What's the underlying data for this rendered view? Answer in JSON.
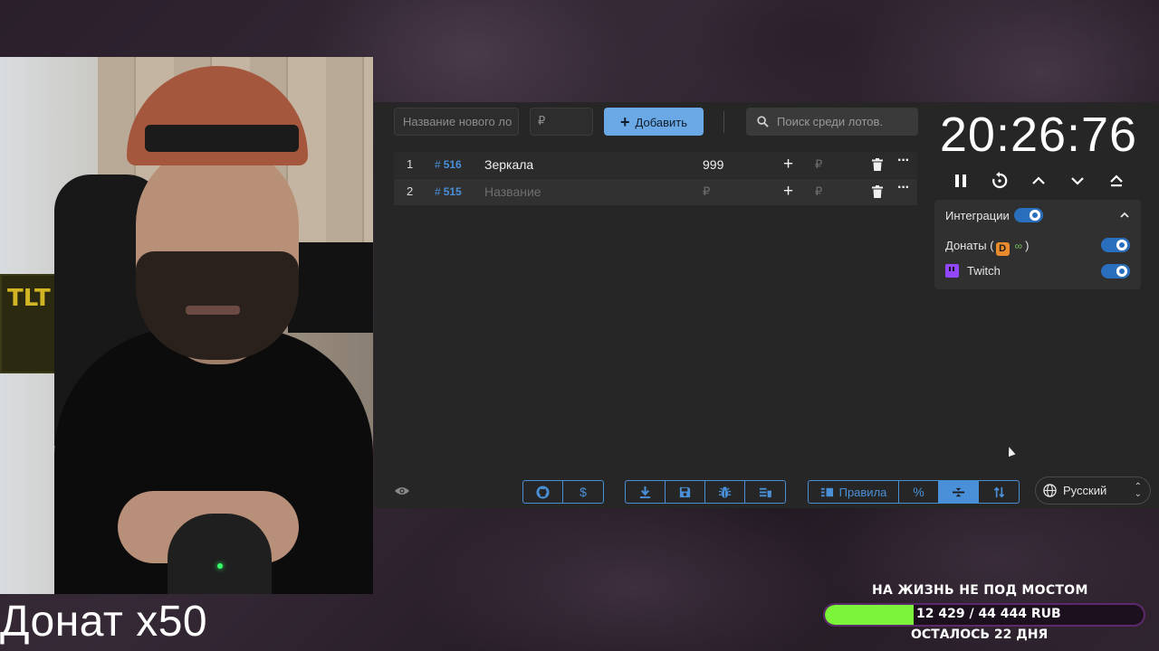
{
  "overlay": {
    "donate_multiplier": "Донат x50"
  },
  "toolbar": {
    "new_lot_placeholder": "Название нового ло",
    "price_placeholder": "₽",
    "add_label": "Добавить",
    "search_placeholder": "Поиск среди лотов."
  },
  "lots": [
    {
      "index": "1",
      "hash": "#",
      "id": "516",
      "name": "Зеркала",
      "amount": "999",
      "add": "+",
      "currency": "₽",
      "more": "···"
    },
    {
      "index": "2",
      "hash": "#",
      "id": "515",
      "name": "Название",
      "amount": "₽",
      "add": "+",
      "currency": "₽",
      "more": "···"
    }
  ],
  "timer": {
    "value": "20:26:76"
  },
  "integrations": {
    "title": "Интеграции",
    "enabled": true,
    "donations_label_prefix": "Донаты (",
    "donations_icon_letter": "D",
    "donations_icon_loop": "∞",
    "donations_label_suffix": ")",
    "donations_enabled": true,
    "twitch_label": "Twitch",
    "twitch_enabled": true
  },
  "bottom_toolbar": {
    "dollar_label": "$",
    "rules_label": "Правила",
    "percent_label": "%",
    "language": "Русский"
  },
  "goal": {
    "title": "НА ЖИЗНЬ НЕ ПОД МОСТОМ",
    "amount_text": "12 429 / 44 444 RUB",
    "remaining_text": "ОСТАЛОСЬ 22 ДНЯ",
    "progress": 0.2797,
    "fill_color": "#7cf43a"
  },
  "colors": {
    "accent": "#4a90d9",
    "add_button": "#6aa9e6",
    "app_bg": "#262626",
    "twitch": "#9146ff",
    "donations": "#e98a2d"
  },
  "icons": {
    "search": "search-icon",
    "pause": "pause-icon",
    "reset": "reset-icon",
    "up": "chevron-up-icon",
    "down": "chevron-down-icon",
    "eject": "eject-icon",
    "github": "github-icon",
    "download": "download-icon",
    "save": "save-icon",
    "bug": "bug-icon",
    "clear": "clear-list-icon",
    "rules": "list-icon",
    "split": "split-icon",
    "sort": "sort-icon",
    "globe": "globe-icon",
    "eye": "eye-icon",
    "trash": "trash-icon"
  }
}
